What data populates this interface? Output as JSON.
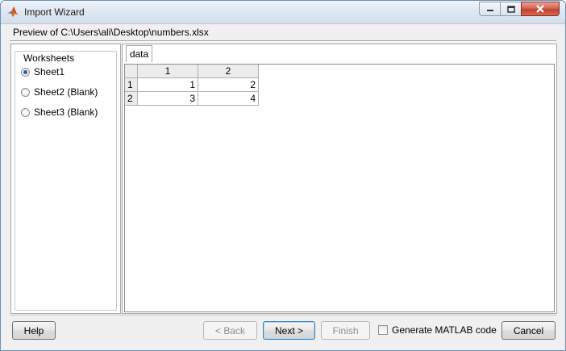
{
  "window": {
    "title": "Import Wizard"
  },
  "preview": {
    "label": "Preview of C:\\Users\\ali\\Desktop\\numbers.xlsx"
  },
  "worksheets": {
    "title": "Worksheets",
    "items": [
      {
        "label": "Sheet1",
        "selected": true
      },
      {
        "label": "Sheet2 (Blank)",
        "selected": false
      },
      {
        "label": "Sheet3 (Blank)",
        "selected": false
      }
    ]
  },
  "data_tab": {
    "label": "data"
  },
  "table": {
    "columns": [
      "1",
      "2"
    ],
    "rows": [
      {
        "header": "1",
        "cells": [
          "1",
          "2"
        ]
      },
      {
        "header": "2",
        "cells": [
          "3",
          "4"
        ]
      }
    ]
  },
  "buttons": {
    "help": "Help",
    "back": "< Back",
    "next": "Next >",
    "finish": "Finish",
    "cancel": "Cancel"
  },
  "generate_code": {
    "label": "Generate MATLAB code",
    "checked": false
  },
  "colors": {
    "title_bar": "#dfe8f2",
    "close_button": "#c4412c",
    "accent": "#3c7fb1"
  }
}
